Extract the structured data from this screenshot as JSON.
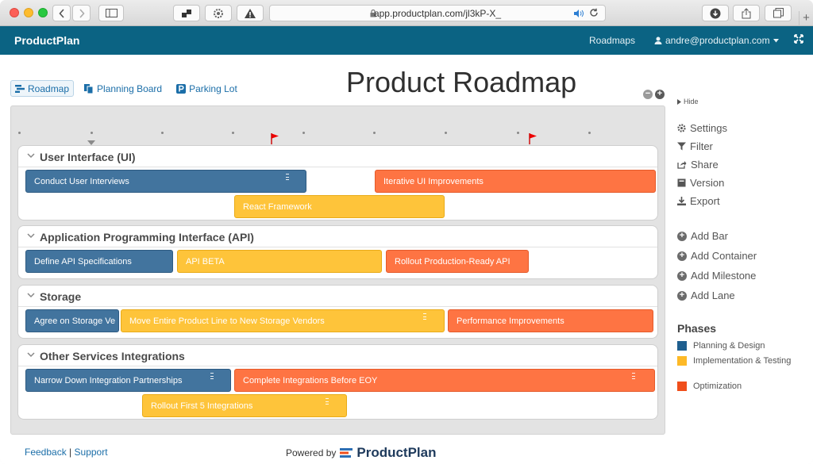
{
  "browser": {
    "url": "app.productplan.com/jl3kP-X_"
  },
  "header": {
    "brand": "ProductPlan",
    "roadmaps_link": "Roadmaps",
    "user_email": "andre@productplan.com"
  },
  "view_tabs": [
    {
      "label": "Roadmap",
      "active": true
    },
    {
      "label": "Planning Board",
      "active": false
    },
    {
      "label": "Parking Lot",
      "active": false
    }
  ],
  "page": {
    "title": "Product Roadmap"
  },
  "phases": {
    "title": "Phases",
    "items": [
      {
        "label": "Planning & Design",
        "color": "#1f5f8f"
      },
      {
        "label": "Implementation & Testing",
        "color": "#fdb927"
      },
      {
        "label": "Optimization",
        "color": "#f04e1b"
      }
    ]
  },
  "lanes": [
    {
      "title": "User Interface (UI)",
      "bars": [
        {
          "label": "Conduct User Interviews",
          "phase": "blue"
        },
        {
          "label": "Iterative UI Improvements",
          "phase": "orange"
        },
        {
          "label": "React Framework",
          "phase": "yellow"
        }
      ]
    },
    {
      "title": "Application Programming Interface (API)",
      "bars": [
        {
          "label": "Define API Specifications",
          "phase": "blue"
        },
        {
          "label": "API BETA",
          "phase": "yellow"
        },
        {
          "label": "Rollout Production-Ready API",
          "phase": "orange"
        }
      ]
    },
    {
      "title": "Storage",
      "bars": [
        {
          "label": "Agree on Storage Ve",
          "phase": "blue"
        },
        {
          "label": "Move Entire Product Line to New Storage Vendors",
          "phase": "yellow"
        },
        {
          "label": "Performance Improvements",
          "phase": "orange"
        }
      ]
    },
    {
      "title": "Other Services Integrations",
      "bars": [
        {
          "label": "Narrow Down Integration Partnerships",
          "phase": "blue"
        },
        {
          "label": "Complete Integrations Before EOY",
          "phase": "orange"
        },
        {
          "label": "Rollout First 5 Integrations",
          "phase": "yellow"
        }
      ]
    }
  ],
  "sidebar": {
    "hide_label": "Hide",
    "actions": [
      {
        "label": "Settings",
        "icon": "gear-icon"
      },
      {
        "label": "Filter",
        "icon": "filter-icon"
      },
      {
        "label": "Share",
        "icon": "share-icon"
      },
      {
        "label": "Version",
        "icon": "version-icon"
      },
      {
        "label": "Export",
        "icon": "download-icon"
      }
    ],
    "add_actions": [
      {
        "label": "Add Bar"
      },
      {
        "label": "Add Container"
      },
      {
        "label": "Add Milestone"
      },
      {
        "label": "Add Lane"
      }
    ]
  },
  "footer": {
    "feedback": "Feedback",
    "separator": "|",
    "support": "Support",
    "powered_by": "Powered by",
    "powered_brand": "ProductPlan"
  }
}
